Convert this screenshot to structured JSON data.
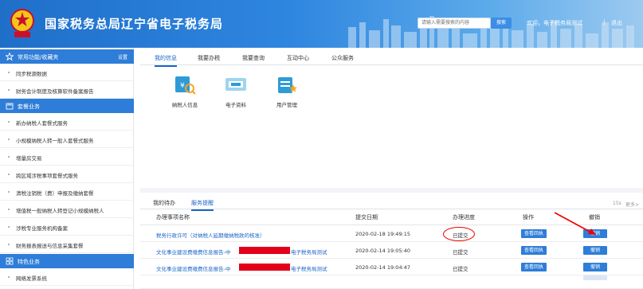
{
  "header": {
    "title": "国家税务总局辽宁省电子税务局",
    "search_placeholder": "请输入需要搜索的内容",
    "search_button": "搜索",
    "welcome": "欢迎，电子税务局测试",
    "separator": "|",
    "logout": "退出",
    "colors": {
      "bar": "#2f86df",
      "accent": "#3a8ee6"
    }
  },
  "sidebar": {
    "sections": [
      {
        "title": "常用功能/收藏夹",
        "setting": "设置",
        "icon": "star-icon",
        "items": [
          "同步税源数据",
          "财务会计制度及核算软件备案报告"
        ]
      },
      {
        "title": "套餐业务",
        "icon": "package-icon",
        "items": [
          "新办纳税人套餐式服务",
          "小规模纳税人转一般人套餐式服务",
          "增量房交易",
          "跨区域涉税事项套餐式服务",
          "清税注销税（费）申报及缴纳套餐",
          "增值税一般纳税人转登记小规模纳税人",
          "涉税专业服务机构备案",
          "财务报表报送与信息采集套餐"
        ]
      },
      {
        "title": "特色业务",
        "icon": "grid-icon",
        "items": [
          "网络发票系统"
        ]
      }
    ]
  },
  "main": {
    "tabs": [
      "我的信息",
      "我要办税",
      "我要查询",
      "互动中心",
      "公众服务"
    ],
    "active_tab": 0,
    "quick_links": [
      {
        "label": "纳税人信息",
        "icon": "taxpayer-info-icon"
      },
      {
        "label": "电子资料",
        "icon": "electronic-documents-icon"
      },
      {
        "label": "用户管理",
        "icon": "user-management-icon"
      }
    ],
    "bottom_tabs": [
      "我的待办",
      "服务提醒"
    ],
    "active_bottom_tab": 1,
    "count": "15s",
    "more": "更多>",
    "table": {
      "headers": [
        "办理事项名称",
        "提交日期",
        "办理进度",
        "操作",
        "撤销"
      ],
      "rows": [
        {
          "name": "税务行政许可（对纳税人延期缴纳税款的核准）",
          "date": "2020-02-18 19:49:15",
          "status": "已提交",
          "action": "查看回执",
          "cancel": "撤销",
          "redacted": false
        },
        {
          "name_prefix": "文化事业建设费缴费信息报告-中",
          "name_suffix": "电子税务局测试",
          "date": "2020-02-14 19:05:40",
          "status": "已提交",
          "action": "查看回执",
          "cancel": "撤销",
          "redacted": true
        },
        {
          "name_prefix": "文化事业建设费缴费信息报告-中",
          "name_suffix": "电子税务局测试",
          "date": "2020-02-14 19:04:47",
          "status": "已提交",
          "action": "查看回执",
          "cancel": "撤销",
          "redacted": true
        }
      ]
    },
    "annotation_color": "#e00000"
  }
}
